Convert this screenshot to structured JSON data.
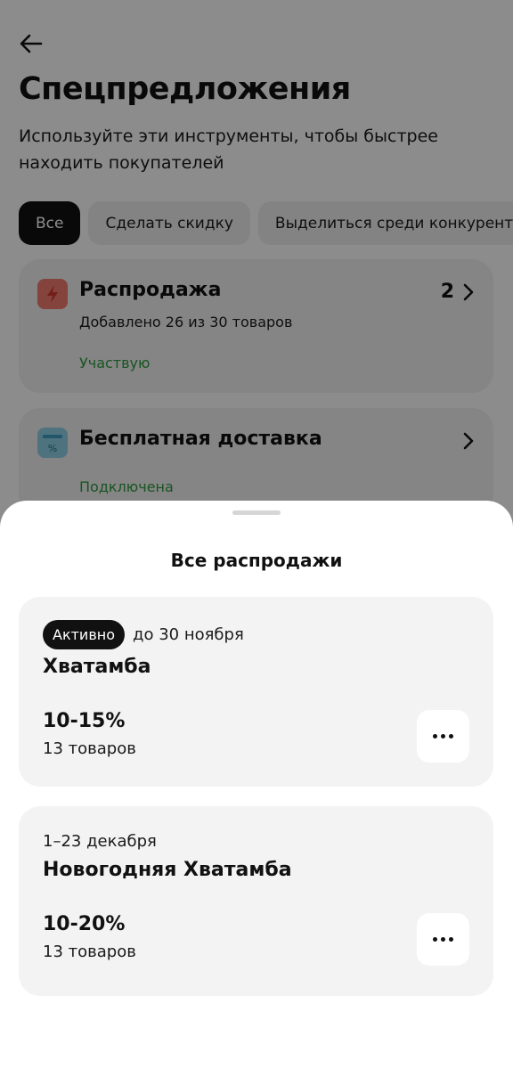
{
  "page": {
    "title": "Спецпредложения",
    "subtitle": "Используйте эти инструменты, чтобы быстрее находить покупателей",
    "filters": [
      "Все",
      "Сделать скидку",
      "Выделиться среди конкурентов"
    ],
    "active_filter": "Все",
    "tools": [
      {
        "title": "Распродажа",
        "description": "Добавлено 26 из 30 товаров",
        "status": "Участвую",
        "count": "2",
        "icon": "lightning-icon"
      },
      {
        "title": "Бесплатная доставка",
        "status": "Подключена",
        "icon": "delivery-box-icon"
      }
    ]
  },
  "sheet": {
    "title": "Все распродажи",
    "sales": [
      {
        "badge": "Активно",
        "date": "до 30 ноября",
        "name": "Хватамба",
        "discount": "10-15%",
        "products": "13 товаров"
      },
      {
        "date": "1–23 декабря",
        "name": "Новогодняя Хватамба",
        "discount": "10-20%",
        "products": "13 товаров"
      }
    ]
  },
  "colors": {
    "status_green": "#2e9a3e",
    "chip_active": "#111111",
    "card_bg": "#f3f3f3",
    "sale_icon": "#f07a6e",
    "delivery_icon": "#8fd2e8",
    "overlay": "rgba(0,0,0,0.45)"
  }
}
